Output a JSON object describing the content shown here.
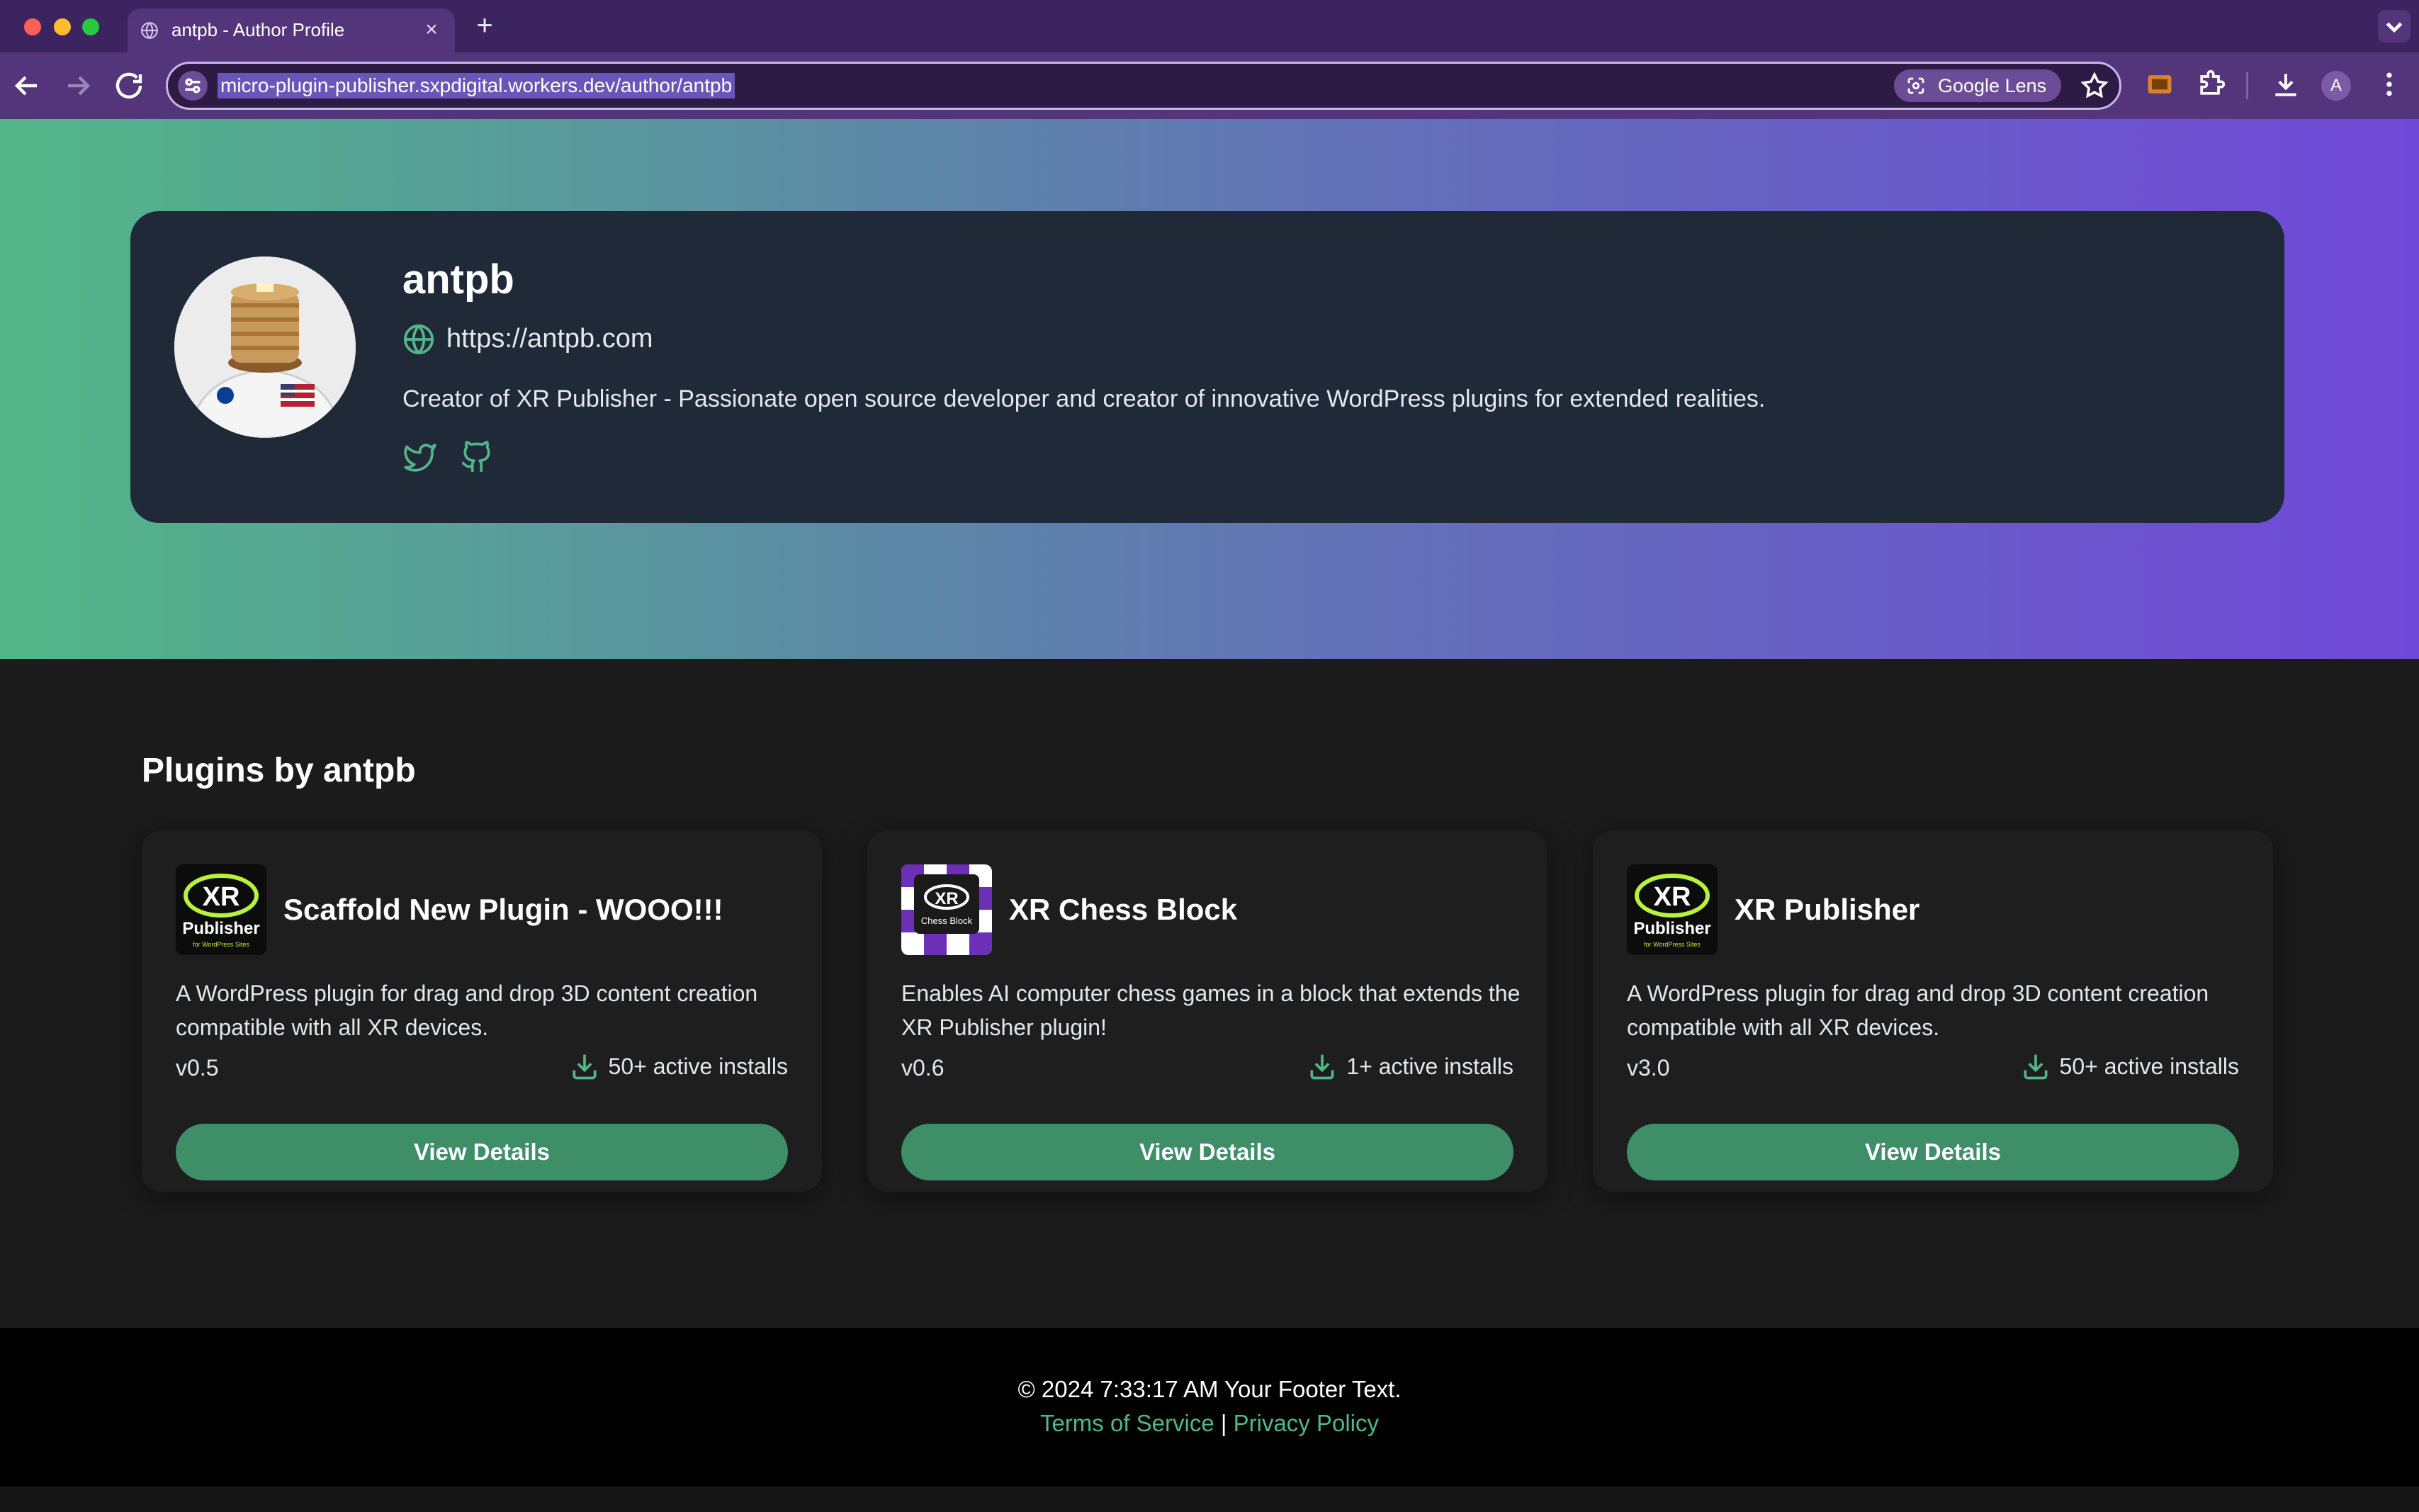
{
  "browser": {
    "tab_title": "antpb - Author Profile",
    "url": "micro-plugin-publisher.sxpdigital.workers.dev/author/antpb",
    "lens_label": "Google Lens",
    "profile_initial": "A"
  },
  "author": {
    "name": "antpb",
    "website": "https://antpb.com",
    "bio": "Creator of XR Publisher - Passionate open source developer and creator of innovative WordPress plugins for extended realities.",
    "socials": [
      "twitter-icon",
      "github-icon"
    ]
  },
  "plugins_section": {
    "title": "Plugins by antpb",
    "cards": [
      {
        "title": "Scaffold New Plugin - WOOO!!!",
        "description": "A WordPress plugin for drag and drop 3D content creation compatible with all XR devices.",
        "version": "v0.5",
        "installs": "50+ active installs",
        "button": "View Details",
        "logo_text": "XR",
        "logo_sub": "Publisher",
        "logo_tag": "for WordPress Sites"
      },
      {
        "title": "XR Chess Block",
        "description": "Enables AI computer chess games in a block that extends the XR Publisher plugin!",
        "version": "v0.6",
        "installs": "1+ active installs",
        "button": "View Details",
        "logo_text": "XR",
        "logo_sub": "Chess Block"
      },
      {
        "title": "XR Publisher",
        "description": "A WordPress plugin for drag and drop 3D content creation compatible with all XR devices.",
        "version": "v3.0",
        "installs": "50+ active installs",
        "button": "View Details",
        "logo_text": "XR",
        "logo_sub": "Publisher",
        "logo_tag": "for WordPress Sites"
      }
    ]
  },
  "footer": {
    "copyright": "© 2024 7:33:17 AM Your Footer Text.",
    "terms": "Terms of Service",
    "separator": " | ",
    "privacy": "Privacy Policy"
  },
  "colors": {
    "accent": "#52b788",
    "button": "#3e8f68",
    "card_bg": "#1f2937",
    "gradient_start": "#52b788",
    "gradient_end": "#7048d8"
  }
}
